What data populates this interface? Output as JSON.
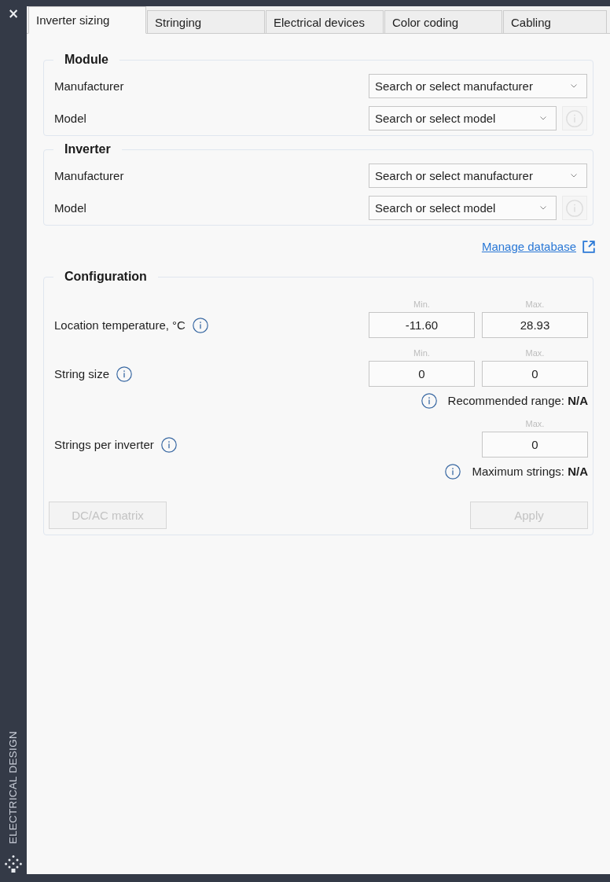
{
  "sidebar": {
    "close": "×",
    "title": "ELECTRICAL DESIGN"
  },
  "tabs": [
    {
      "label": "Inverter sizing",
      "selected": true
    },
    {
      "label": "Stringing",
      "selected": false
    },
    {
      "label": "Electrical devices",
      "selected": false
    },
    {
      "label": "Color coding",
      "selected": false
    },
    {
      "label": "Cabling",
      "selected": false
    }
  ],
  "groups": [
    {
      "title": "Module",
      "fields": [
        {
          "label": "Manufacturer",
          "placeholder": "Search or select manufacturer"
        },
        {
          "label": "Model",
          "placeholder": "Search or select model",
          "info_button": {
            "disabled": true
          }
        }
      ]
    },
    {
      "title": "Inverter",
      "fields": [
        {
          "label": "Manufacturer",
          "placeholder": "Search or select manufacturer"
        },
        {
          "label": "Model",
          "placeholder": "Search or select model",
          "info_button": {
            "disabled": true
          }
        }
      ]
    }
  ],
  "link": {
    "label": "Manage database"
  },
  "configuration": {
    "title": "Configuration",
    "rows": [
      {
        "label": "Location temperature, °C",
        "inputs": [
          {
            "caption": "Min.",
            "value": "-11.60"
          },
          {
            "caption": "Max.",
            "value": "28.93"
          }
        ]
      },
      {
        "label": "String size",
        "inputs": [
          {
            "caption": "Min.",
            "value": "0"
          },
          {
            "caption": "Max.",
            "value": "0"
          }
        ],
        "note": "Recommended range: **N/A**"
      },
      {
        "label": "Strings per inverter",
        "inputs": [
          {
            "caption": "Max.",
            "value": "0"
          }
        ],
        "note": "Maximum strings: **N/A**"
      }
    ],
    "buttons": [
      {
        "label": "DC/AC matrix",
        "disabled": true
      },
      {
        "label": "Apply",
        "disabled": true
      }
    ]
  }
}
